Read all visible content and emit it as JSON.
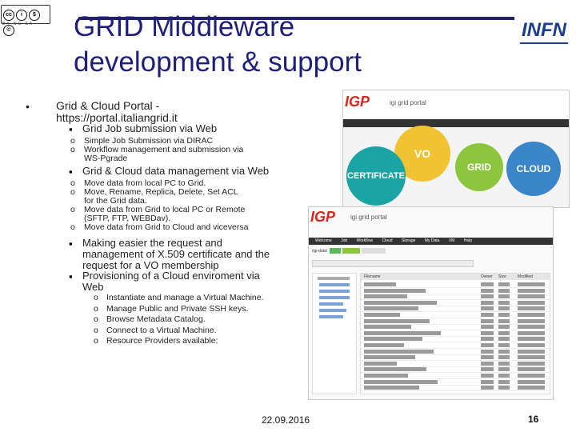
{
  "header": {
    "title_line1": "GRID Middleware",
    "title_line2": "development & support",
    "logo_text": "INFN",
    "cc_text": "BY NC SA"
  },
  "content": {
    "item1": "Grid & Cloud Portal -",
    "item1_url": "https://portal.italiangrid.it",
    "sub1": "Grid Job submission via Web",
    "sub1_items": [
      "Simple Job Submission via DIRAC",
      "Workflow management and submission via",
      "WS-Pgrade"
    ],
    "sub2": "Grid & Cloud data management via Web",
    "sub2_items": [
      "Move data from local PC to Grid.",
      "Move, Rename, Replica, Delete, Set ACL",
      "for the Grid data.",
      "Move data from Grid to local PC or Remote",
      "(SFTP, FTP, WEBDav).",
      "Move data from Grid to Cloud and viceversa"
    ],
    "sub3_l1": "Making easier the request and",
    "sub3_l2": "management of X.509 certificate and the",
    "sub3_l3": "request for a VO membership",
    "sub4_l1": "Provisioning of a Cloud enviroment via",
    "sub4_l2": "Web",
    "sub4_items": [
      "Instantiate and manage a Virtual Machine.",
      "Manage Public and Private SSH keys.",
      "Browse Metadata Catalog.",
      "Connect to a Virtual Machine.",
      "Resource Providers available:"
    ]
  },
  "portal": {
    "brand1": "IGP",
    "brand1_sub": "igi grid portal",
    "bubbles": [
      "CERTIFICATE",
      "VO",
      "GRID",
      "CLOUD"
    ],
    "brand2": "IGP",
    "brand2_sub": "igi grid portal",
    "menu": [
      "Welcome",
      "Job",
      "Workflow",
      "Cloud",
      "Storage",
      "My Data",
      "VM",
      "Help"
    ],
    "path_label": "/igi-data/",
    "columns": [
      "Filename",
      "Owner",
      "Size",
      "Modified"
    ]
  },
  "footer": {
    "date": "22.09.2016",
    "page": "16"
  }
}
